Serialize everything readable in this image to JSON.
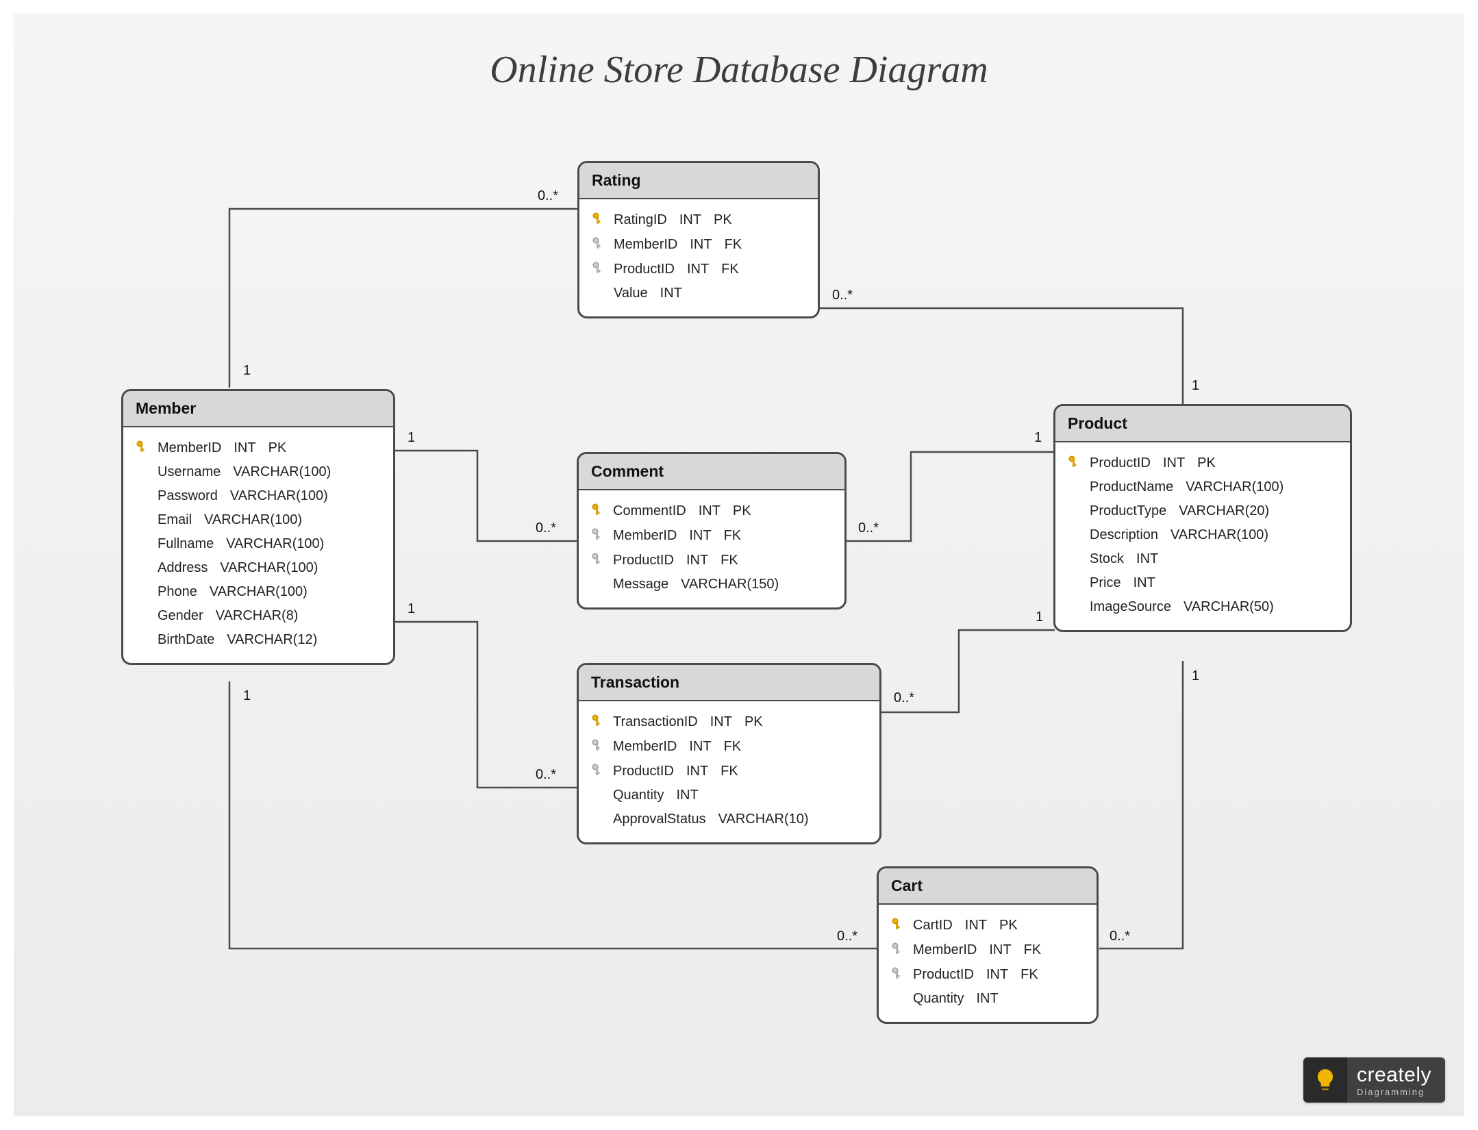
{
  "title": "Online Store Database Diagram",
  "logo": {
    "brand": "creately",
    "tagline": "Diagramming"
  },
  "key_icons": {
    "pk_name": "primary-key-icon",
    "fk_name": "foreign-key-icon"
  },
  "entities": {
    "member": {
      "title": "Member",
      "fields": [
        {
          "name": "MemberID",
          "type": "INT",
          "key": "PK"
        },
        {
          "name": "Username",
          "type": "VARCHAR(100)",
          "key": ""
        },
        {
          "name": "Password",
          "type": "VARCHAR(100)",
          "key": ""
        },
        {
          "name": "Email",
          "type": "VARCHAR(100)",
          "key": ""
        },
        {
          "name": "Fullname",
          "type": "VARCHAR(100)",
          "key": ""
        },
        {
          "name": "Address",
          "type": "VARCHAR(100)",
          "key": ""
        },
        {
          "name": "Phone",
          "type": "VARCHAR(100)",
          "key": ""
        },
        {
          "name": "Gender",
          "type": "VARCHAR(8)",
          "key": ""
        },
        {
          "name": "BirthDate",
          "type": "VARCHAR(12)",
          "key": ""
        }
      ]
    },
    "rating": {
      "title": "Rating",
      "fields": [
        {
          "name": "RatingID",
          "type": "INT",
          "key": "PK"
        },
        {
          "name": "MemberID",
          "type": "INT",
          "key": "FK"
        },
        {
          "name": "ProductID",
          "type": "INT",
          "key": "FK"
        },
        {
          "name": "Value",
          "type": "INT",
          "key": ""
        }
      ]
    },
    "product": {
      "title": "Product",
      "fields": [
        {
          "name": "ProductID",
          "type": "INT",
          "key": "PK"
        },
        {
          "name": "ProductName",
          "type": "VARCHAR(100)",
          "key": ""
        },
        {
          "name": "ProductType",
          "type": "VARCHAR(20)",
          "key": ""
        },
        {
          "name": "Description",
          "type": "VARCHAR(100)",
          "key": ""
        },
        {
          "name": "Stock",
          "type": "INT",
          "key": ""
        },
        {
          "name": "Price",
          "type": "INT",
          "key": ""
        },
        {
          "name": "ImageSource",
          "type": "VARCHAR(50)",
          "key": ""
        }
      ]
    },
    "comment": {
      "title": "Comment",
      "fields": [
        {
          "name": "CommentID",
          "type": "INT",
          "key": "PK"
        },
        {
          "name": "MemberID",
          "type": "INT",
          "key": "FK"
        },
        {
          "name": "ProductID",
          "type": "INT",
          "key": "FK"
        },
        {
          "name": "Message",
          "type": "VARCHAR(150)",
          "key": ""
        }
      ]
    },
    "transaction": {
      "title": "Transaction",
      "fields": [
        {
          "name": "TransactionID",
          "type": "INT",
          "key": "PK"
        },
        {
          "name": "MemberID",
          "type": "INT",
          "key": "FK"
        },
        {
          "name": "ProductID",
          "type": "INT",
          "key": "FK"
        },
        {
          "name": "Quantity",
          "type": "INT",
          "key": ""
        },
        {
          "name": "ApprovalStatus",
          "type": "VARCHAR(10)",
          "key": ""
        }
      ]
    },
    "cart": {
      "title": "Cart",
      "fields": [
        {
          "name": "CartID",
          "type": "INT",
          "key": "PK"
        },
        {
          "name": "MemberID",
          "type": "INT",
          "key": "FK"
        },
        {
          "name": "ProductID",
          "type": "INT",
          "key": "FK"
        },
        {
          "name": "Quantity",
          "type": "INT",
          "key": ""
        }
      ]
    }
  },
  "cardinalities": {
    "member_rating_member": "1",
    "member_rating_rating": "0..*",
    "member_comment_member": "1",
    "member_comment_comment": "0..*",
    "member_transaction_member": "1",
    "member_transaction_transaction": "0..*",
    "member_cart_member": "1",
    "member_cart_cart": "0..*",
    "product_rating_product": "1",
    "product_rating_rating": "0..*",
    "product_comment_product": "1",
    "product_comment_comment": "0..*",
    "product_transaction_product": "1",
    "product_transaction_transaction": "0..*",
    "product_cart_product": "1",
    "product_cart_cart": "0..*"
  },
  "relationships": [
    {
      "from": "Member",
      "to": "Rating",
      "from_card": "1",
      "to_card": "0..*"
    },
    {
      "from": "Member",
      "to": "Comment",
      "from_card": "1",
      "to_card": "0..*"
    },
    {
      "from": "Member",
      "to": "Transaction",
      "from_card": "1",
      "to_card": "0..*"
    },
    {
      "from": "Member",
      "to": "Cart",
      "from_card": "1",
      "to_card": "0..*"
    },
    {
      "from": "Product",
      "to": "Rating",
      "from_card": "1",
      "to_card": "0..*"
    },
    {
      "from": "Product",
      "to": "Comment",
      "from_card": "1",
      "to_card": "0..*"
    },
    {
      "from": "Product",
      "to": "Transaction",
      "from_card": "1",
      "to_card": "0..*"
    },
    {
      "from": "Product",
      "to": "Cart",
      "from_card": "1",
      "to_card": "0..*"
    }
  ]
}
